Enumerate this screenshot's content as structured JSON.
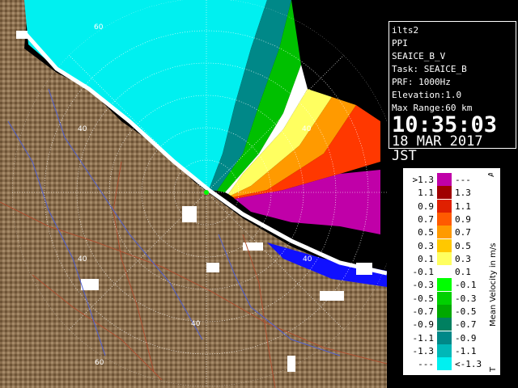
{
  "info": {
    "lines": [
      "ilts2",
      "PPI",
      "SEAICE_B_V",
      "Task: SEAICE_B",
      "PRF: 1000Hz",
      "Elevation:1.0",
      "Max Range:60 km"
    ],
    "time": "10:35:03",
    "date": "18 MAR 2017 JST"
  },
  "legend": {
    "unit_label": "Mean Velocity in m/s",
    "top_marker": "A",
    "bottom_marker": "T",
    "rows": [
      {
        "left": ">1.3",
        "right": "---",
        "color": "#c000a8"
      },
      {
        "left": "1.1",
        "right": "1.3",
        "color": "#a00000"
      },
      {
        "left": "0.9",
        "right": "1.1",
        "color": "#e02000"
      },
      {
        "left": "0.7",
        "right": "0.9",
        "color": "#ff5a00"
      },
      {
        "left": "0.5",
        "right": "0.7",
        "color": "#ff9a00"
      },
      {
        "left": "0.3",
        "right": "0.5",
        "color": "#ffc800"
      },
      {
        "left": "0.1",
        "right": "0.3",
        "color": "#ffff60"
      },
      {
        "left": "-0.1",
        "right": "0.1",
        "color": "#ffffff"
      },
      {
        "left": "-0.3",
        "right": "-0.1",
        "color": "#00ff00"
      },
      {
        "left": "-0.5",
        "right": "-0.3",
        "color": "#00d000"
      },
      {
        "left": "-0.7",
        "right": "-0.5",
        "color": "#00a800"
      },
      {
        "left": "-0.9",
        "right": "-0.7",
        "color": "#008060"
      },
      {
        "left": "-1.1",
        "right": "-0.9",
        "color": "#008888"
      },
      {
        "left": "-1.3",
        "right": "-1.1",
        "color": "#00b8b8"
      },
      {
        "left": "---",
        "right": "<-1.3",
        "color": "#00f0f0"
      }
    ]
  },
  "map": {
    "range_labels": [
      "60",
      "40",
      "40",
      "40",
      "40",
      "60"
    ],
    "colors": {
      "sea_ice_inbound": "#00f0f0",
      "land": "#8a6e4e",
      "sea_open": "#1010ff",
      "outbound_strong": "#c000a8",
      "range_ring": "#ffffff",
      "road": "#b05030",
      "river": "#5060d0"
    }
  }
}
